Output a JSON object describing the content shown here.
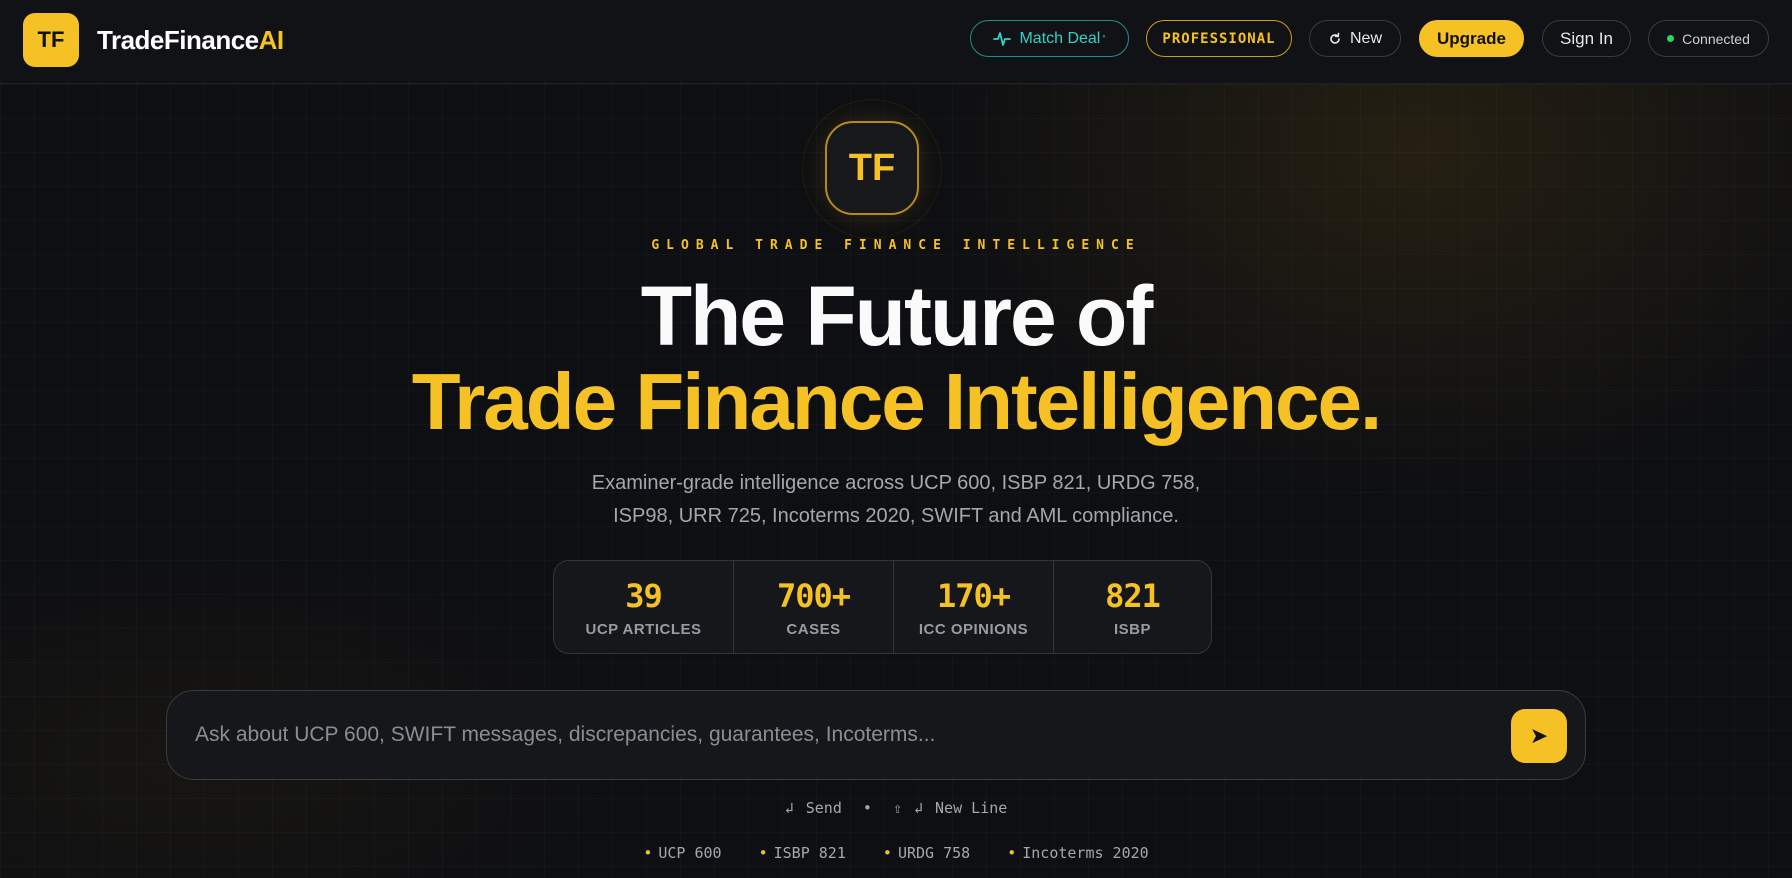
{
  "colors": {
    "accent": "#f5c125",
    "teal": "#37d0c6",
    "status_green": "#2fd36b",
    "background": "#0e0f12"
  },
  "nav": {
    "logo_text": "TF",
    "brand_main": "TradeFinance",
    "brand_suffix": "AI",
    "match_deal": "Match Deal",
    "match_deal_sup": "°",
    "plan_badge": "PROFESSIONAL",
    "new_label": "New",
    "upgrade_label": "Upgrade",
    "signin_label": "Sign In",
    "status_label": "Connected"
  },
  "hero": {
    "logo_text": "TF",
    "kicker": "GLOBAL TRADE FINANCE INTELLIGENCE",
    "title_line1": "The Future of",
    "title_line2": "Trade Finance Intelligence.",
    "desc_line1": "Examiner-grade intelligence across UCP 600, ISBP 821, URDG 758,",
    "desc_line2": "ISP98, URR 725, Incoterms 2020, SWIFT and AML compliance."
  },
  "stats": [
    {
      "value": "39",
      "label": "UCP ARTICLES"
    },
    {
      "value": "700+",
      "label": "CASES"
    },
    {
      "value": "170+",
      "label": "ICC OPINIONS"
    },
    {
      "value": "821",
      "label": "ISBP"
    }
  ],
  "search": {
    "placeholder": "Ask about UCP 600, SWIFT messages, discrepancies, guarantees, Incoterms...",
    "send_icon": "➤"
  },
  "hints": {
    "send_icon": "↲",
    "send_label": "Send",
    "separator": "•",
    "shift_icon": "⇧",
    "newline_icon": "↲",
    "newline_label": "New Line"
  },
  "tags": [
    "UCP 600",
    "ISBP 821",
    "URDG 758",
    "Incoterms 2020"
  ]
}
